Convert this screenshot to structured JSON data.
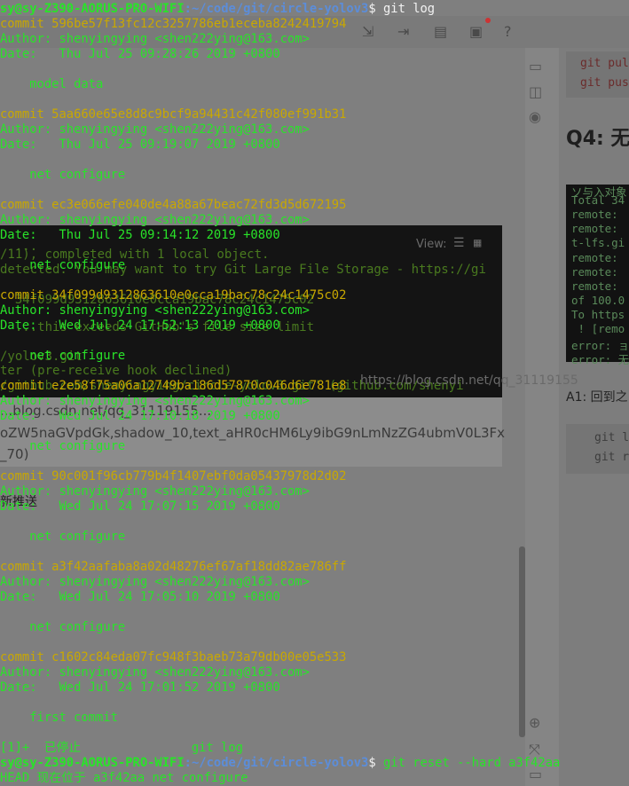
{
  "terminal": {
    "prompt_user": "sy@sy-Z390-AORUS-PRO-WIFI",
    "prompt_path": ":~/code/git/circle-yolov3",
    "prompt_symbol": "$ ",
    "command_1": "git log",
    "commits": [
      {
        "hash_line": "commit 596be57f13fc12c3257786eb1eceba8242419794",
        "author_line": "Author: shenyingying <shen222ying@163.com>",
        "date_line": "Date:   Thu Jul 25 09:28:26 2019 +0800",
        "message": "    model data"
      },
      {
        "hash_line": "commit 5aa660e65e8d8c9bcf9a94431c42f080ef991b31",
        "author_line": "Author: shenyingying <shen222ying@163.com>",
        "date_line": "Date:   Thu Jul 25 09:19:07 2019 +0800",
        "message": "    net configure"
      },
      {
        "hash_line": "commit ec3e066efe040de4a88a67beac72fd3d5d672195",
        "author_line": "Author: shenyingying <shen222ying@163.com>",
        "date_line": "Date:   Thu Jul 25 09:14:12 2019 +0800",
        "message": "    net configure"
      },
      {
        "hash_line": "commit 34f099d9312863610e0cca19bac78c24c1475c02",
        "author_line": "Author: shenyingying <shen222ying@163.com>",
        "date_line": "Date:   Wed Jul 24 17:52:13 2019 +0800",
        "message": "    net configure"
      },
      {
        "hash_line": "commit e2e58f75a06a12749ba186d57870c046d6e781e8",
        "author_line": "Author: shenyingying <shen222ying@163.com>",
        "date_line": "Date:   Wed Jul 24 17:10:18 2019 +0800",
        "message": "    net configure"
      },
      {
        "hash_line": "commit 90c001f96cb779b4f1407ebf0da05437978d2d02",
        "author_line": "Author: shenyingying <shen222ying@163.com>",
        "date_line": "Date:   Wed Jul 24 17:07:15 2019 +0800",
        "message": "    net configure"
      },
      {
        "hash_line": "commit a3f42aafaba8a02d48276ef67af18dd82ae786ff",
        "author_line": "Author: shenyingying <shen222ying@163.com>",
        "date_line": "Date:   Wed Jul 24 17:05:10 2019 +0800",
        "message": "    net configure"
      },
      {
        "hash_line": "commit c1602c84eda07fc948f3baeb73a79db00e05e533",
        "author_line": "Author: shenyingying <shen222ying@163.com>",
        "date_line": "Date:   Wed Jul 24 17:01:52 2019 +0800",
        "message": "    first commit"
      }
    ],
    "job_status": "[1]+  已停止               git log",
    "command_2": "git reset --hard a3f42aa",
    "result": "HEAD 现在位于 a3f42aa net configure"
  },
  "background": {
    "right_code_lines": [
      "git pul",
      "git pus"
    ],
    "right_heading": "Q4: 无",
    "mini_terminal_lines": [
      "ソ与入对象",
      "Total 34",
      "remote:",
      "remote:",
      "t-lfs.gi",
      "remote:",
      "remote:",
      "remote:",
      "of 100.0",
      "To https",
      " ! [remo",
      "error: ョ",
      "error: 无"
    ],
    "answer_text": "A1: 回到之",
    "right_code_lines_2": [
      "git l",
      "git r"
    ],
    "view_label": "View:",
    "dark_panel_lines": [
      "  ...",
      "/11), completed with 1 local object.",
      "detected. You may want to try Git Large File Storage - https://gi",
      "",
      "  34f099d9312863610e0cca19bac78c24c1475c02",
      "",
      "  ...this exceeds GitHub's file size limit",
      "",
      "/yolov3.git",
      "ter (pre-receive hook declined)",
      "/github.com/shenyingying/circle-yolov3.git' (github.com/shenyi"
    ],
    "watermark": "https://blog.csdn.net/qq_31119155",
    "light_panel_lines": [
      "...blog.csdn.net/qq_31119155...",
      "oZW5naGVpdGk,shadow_10,text_aHR0cHM6Ly9ibG9nLmNzZG4ubmV0L3Fx",
      "_70)"
    ],
    "stray_text": "新推送"
  }
}
